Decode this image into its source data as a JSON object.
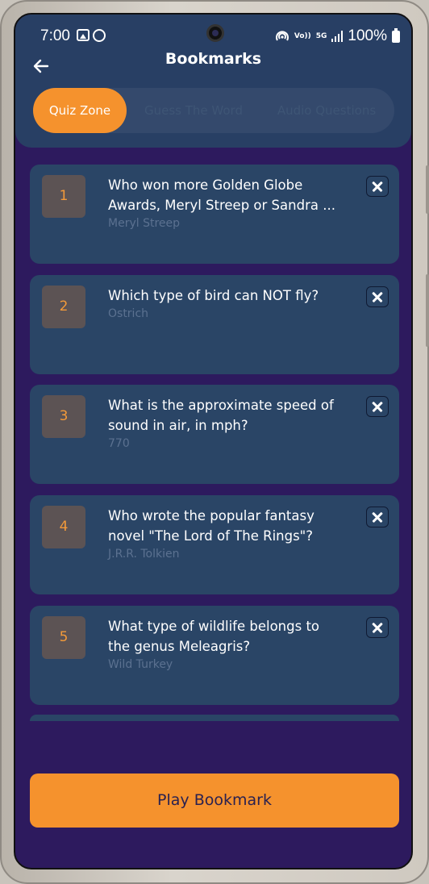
{
  "status_bar": {
    "time": "7:00",
    "network": "5G",
    "volte": "Vo))",
    "battery": "100%"
  },
  "header": {
    "title": "Bookmarks"
  },
  "tabs": [
    {
      "label": "Quiz Zone",
      "active": true
    },
    {
      "label": "Guess The Word",
      "active": false
    },
    {
      "label": "Audio Questions",
      "active": false
    }
  ],
  "bookmarks": [
    {
      "number": "1",
      "question_line1": "Who won more Golden Globe",
      "question_line2": "Awards, Meryl Streep or Sandra ...",
      "answer": "Meryl Streep"
    },
    {
      "number": "2",
      "question_line1": "Which type of bird can NOT fly?",
      "question_line2": "",
      "answer": "Ostrich"
    },
    {
      "number": "3",
      "question_line1": "What is the approximate speed of",
      "question_line2": "sound in air, in mph?",
      "answer": "770"
    },
    {
      "number": "4",
      "question_line1": "Who wrote the popular fantasy",
      "question_line2": "novel \"The Lord of The Rings\"?",
      "answer": "J.R.R. Tolkien"
    },
    {
      "number": "5",
      "question_line1": "What type of wildlife belongs to",
      "question_line2": "the genus Meleagris?",
      "answer": "Wild Turkey"
    }
  ],
  "play_button": {
    "label": "Play Bookmark"
  },
  "colors": {
    "accent": "#f5922d",
    "background": "#2d1a5e",
    "card": "#2a4566",
    "header": "#283f64"
  },
  "icons": {
    "back": "arrow-left-icon",
    "remove": "close-icon"
  }
}
